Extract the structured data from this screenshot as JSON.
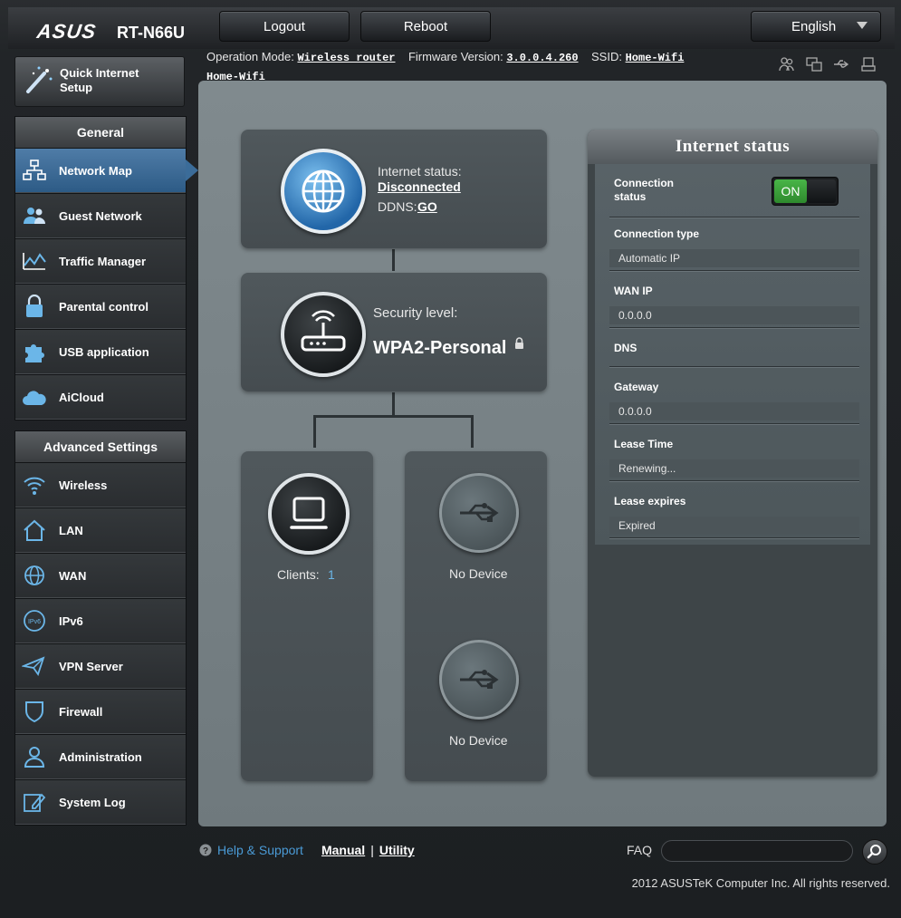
{
  "header": {
    "brand": "ASUS",
    "model": "RT-N66U",
    "logout_label": "Logout",
    "reboot_label": "Reboot",
    "language": "English"
  },
  "infobar": {
    "op_mode_label": "Operation Mode:",
    "op_mode_value": "Wireless router",
    "firmware_label": "Firmware Version:",
    "firmware_value": "3.0.0.4.260",
    "ssid_label": "SSID:",
    "ssid_value_1": "Home-Wifi",
    "ssid_value_2": "Home-Wifi"
  },
  "sidebar": {
    "quick_setup_line1": "Quick Internet",
    "quick_setup_line2": "Setup",
    "general_title": "General",
    "general_items": [
      {
        "label": "Network Map",
        "icon": "network-map-icon"
      },
      {
        "label": "Guest Network",
        "icon": "guest-network-icon"
      },
      {
        "label": "Traffic Manager",
        "icon": "traffic-manager-icon"
      },
      {
        "label": "Parental control",
        "icon": "lock-icon"
      },
      {
        "label": "USB application",
        "icon": "puzzle-icon"
      },
      {
        "label": "AiCloud",
        "icon": "cloud-icon"
      }
    ],
    "advanced_title": "Advanced Settings",
    "advanced_items": [
      {
        "label": "Wireless",
        "icon": "wifi-icon"
      },
      {
        "label": "LAN",
        "icon": "home-icon"
      },
      {
        "label": "WAN",
        "icon": "globe-icon"
      },
      {
        "label": "IPv6",
        "icon": "ipv6-icon"
      },
      {
        "label": "VPN Server",
        "icon": "vpn-icon"
      },
      {
        "label": "Firewall",
        "icon": "shield-icon"
      },
      {
        "label": "Administration",
        "icon": "user-icon"
      },
      {
        "label": "System Log",
        "icon": "edit-icon"
      }
    ]
  },
  "map": {
    "internet_status_label": "Internet status:",
    "internet_status_value": "Disconnected",
    "ddns_label": "DDNS:",
    "ddns_value": "GO",
    "security_label": "Security level:",
    "security_value": "WPA2-Personal",
    "clients_label": "Clients:",
    "clients_count": "1",
    "usb1_label": "No Device",
    "usb2_label": "No Device"
  },
  "status": {
    "title": "Internet status",
    "connection_status_line1": "Connection",
    "connection_status_line2": "status",
    "toggle_label": "ON",
    "connection_type_label": "Connection type",
    "connection_type_value": "Automatic IP",
    "wan_ip_label": "WAN IP",
    "wan_ip_value": "0.0.0.0",
    "dns_label": "DNS",
    "gateway_label": "Gateway",
    "gateway_value": "0.0.0.0",
    "lease_time_label": "Lease Time",
    "lease_time_value": "Renewing...",
    "lease_expires_label": "Lease expires",
    "lease_expires_value": "Expired"
  },
  "footer": {
    "help_label": "Help & Support",
    "manual_label": "Manual",
    "separator": "|",
    "utility_label": "Utility",
    "faq_label": "FAQ",
    "copyright": "2012 ASUSTeK Computer Inc. All rights reserved."
  },
  "colors": {
    "accent_blue": "#3b6c99",
    "toggle_green": "#3ca23b",
    "help_blue": "#4a9bd6"
  }
}
